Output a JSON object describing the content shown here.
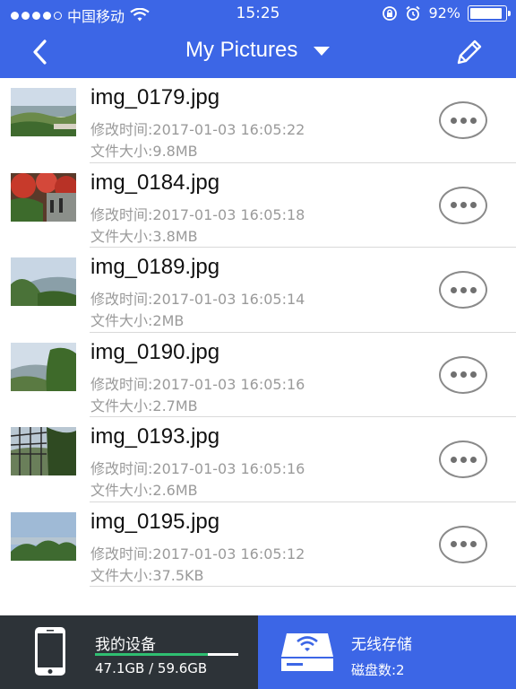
{
  "status_bar": {
    "carrier": "中国移动",
    "time": "15:25",
    "battery_percent": "92%",
    "battery_level": 0.92,
    "signal_bars": 4
  },
  "nav": {
    "title": "My Pictures",
    "back_icon": "chevron-left-icon",
    "dropdown_icon": "caret-down-icon",
    "edit_icon": "pencil-icon"
  },
  "files": [
    {
      "name": "img_0179.jpg",
      "time": "修改时间:2017-01-03 16:05:22",
      "size": "文件大小:9.8MB"
    },
    {
      "name": "img_0184.jpg",
      "time": "修改时间:2017-01-03 16:05:18",
      "size": "文件大小:3.8MB"
    },
    {
      "name": "img_0189.jpg",
      "time": "修改时间:2017-01-03 16:05:14",
      "size": "文件大小:2MB"
    },
    {
      "name": "img_0190.jpg",
      "time": "修改时间:2017-01-03 16:05:16",
      "size": "文件大小:2.7MB"
    },
    {
      "name": "img_0193.jpg",
      "time": "修改时间:2017-01-03 16:05:16",
      "size": "文件大小:2.6MB"
    },
    {
      "name": "img_0195.jpg",
      "time": "修改时间:2017-01-03 16:05:12",
      "size": "文件大小:37.5KB"
    }
  ],
  "bottom": {
    "my_device_label": "我的设备",
    "storage_text": "47.1GB / 59.6GB",
    "storage_used_fraction": 0.79,
    "wireless_label": "无线存储",
    "disk_count": "磁盘数:2"
  },
  "colors": {
    "accent": "#3c66e6",
    "dark_panel": "#2d3338",
    "storage_green": "#2fbf71"
  }
}
